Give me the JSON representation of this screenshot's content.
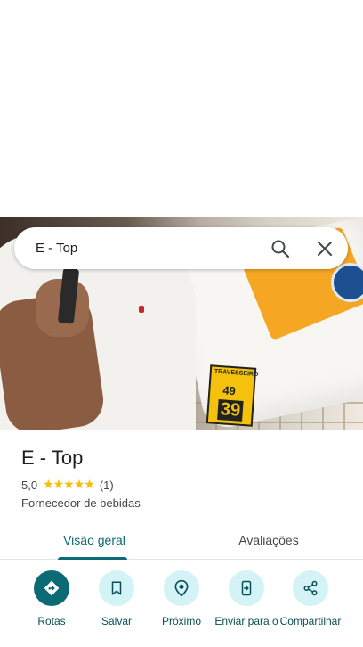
{
  "search": {
    "query": "E - Top"
  },
  "photo": {
    "price_tag_label": "TRAVESSEIRO",
    "price_old": "49",
    "price_new": "39"
  },
  "place": {
    "name": "E - Top",
    "rating": "5,0",
    "stars": "★★★★★",
    "review_count": "(1)",
    "category": "Fornecedor de bebidas"
  },
  "tabs": [
    {
      "label": "Visão geral",
      "active": true
    },
    {
      "label": "Avaliações",
      "active": false
    }
  ],
  "actions": [
    {
      "label": "Rotas",
      "icon": "directions-icon"
    },
    {
      "label": "Salvar",
      "icon": "bookmark-icon"
    },
    {
      "label": "Próximo",
      "icon": "nearby-icon"
    },
    {
      "label": "Enviar para o",
      "icon": "send-to-phone-icon"
    },
    {
      "label": "Compartilhar",
      "icon": "share-icon"
    }
  ],
  "colors": {
    "accent": "#0b6a73",
    "accent_light": "#d3f3f7",
    "star": "#fbbc04"
  }
}
